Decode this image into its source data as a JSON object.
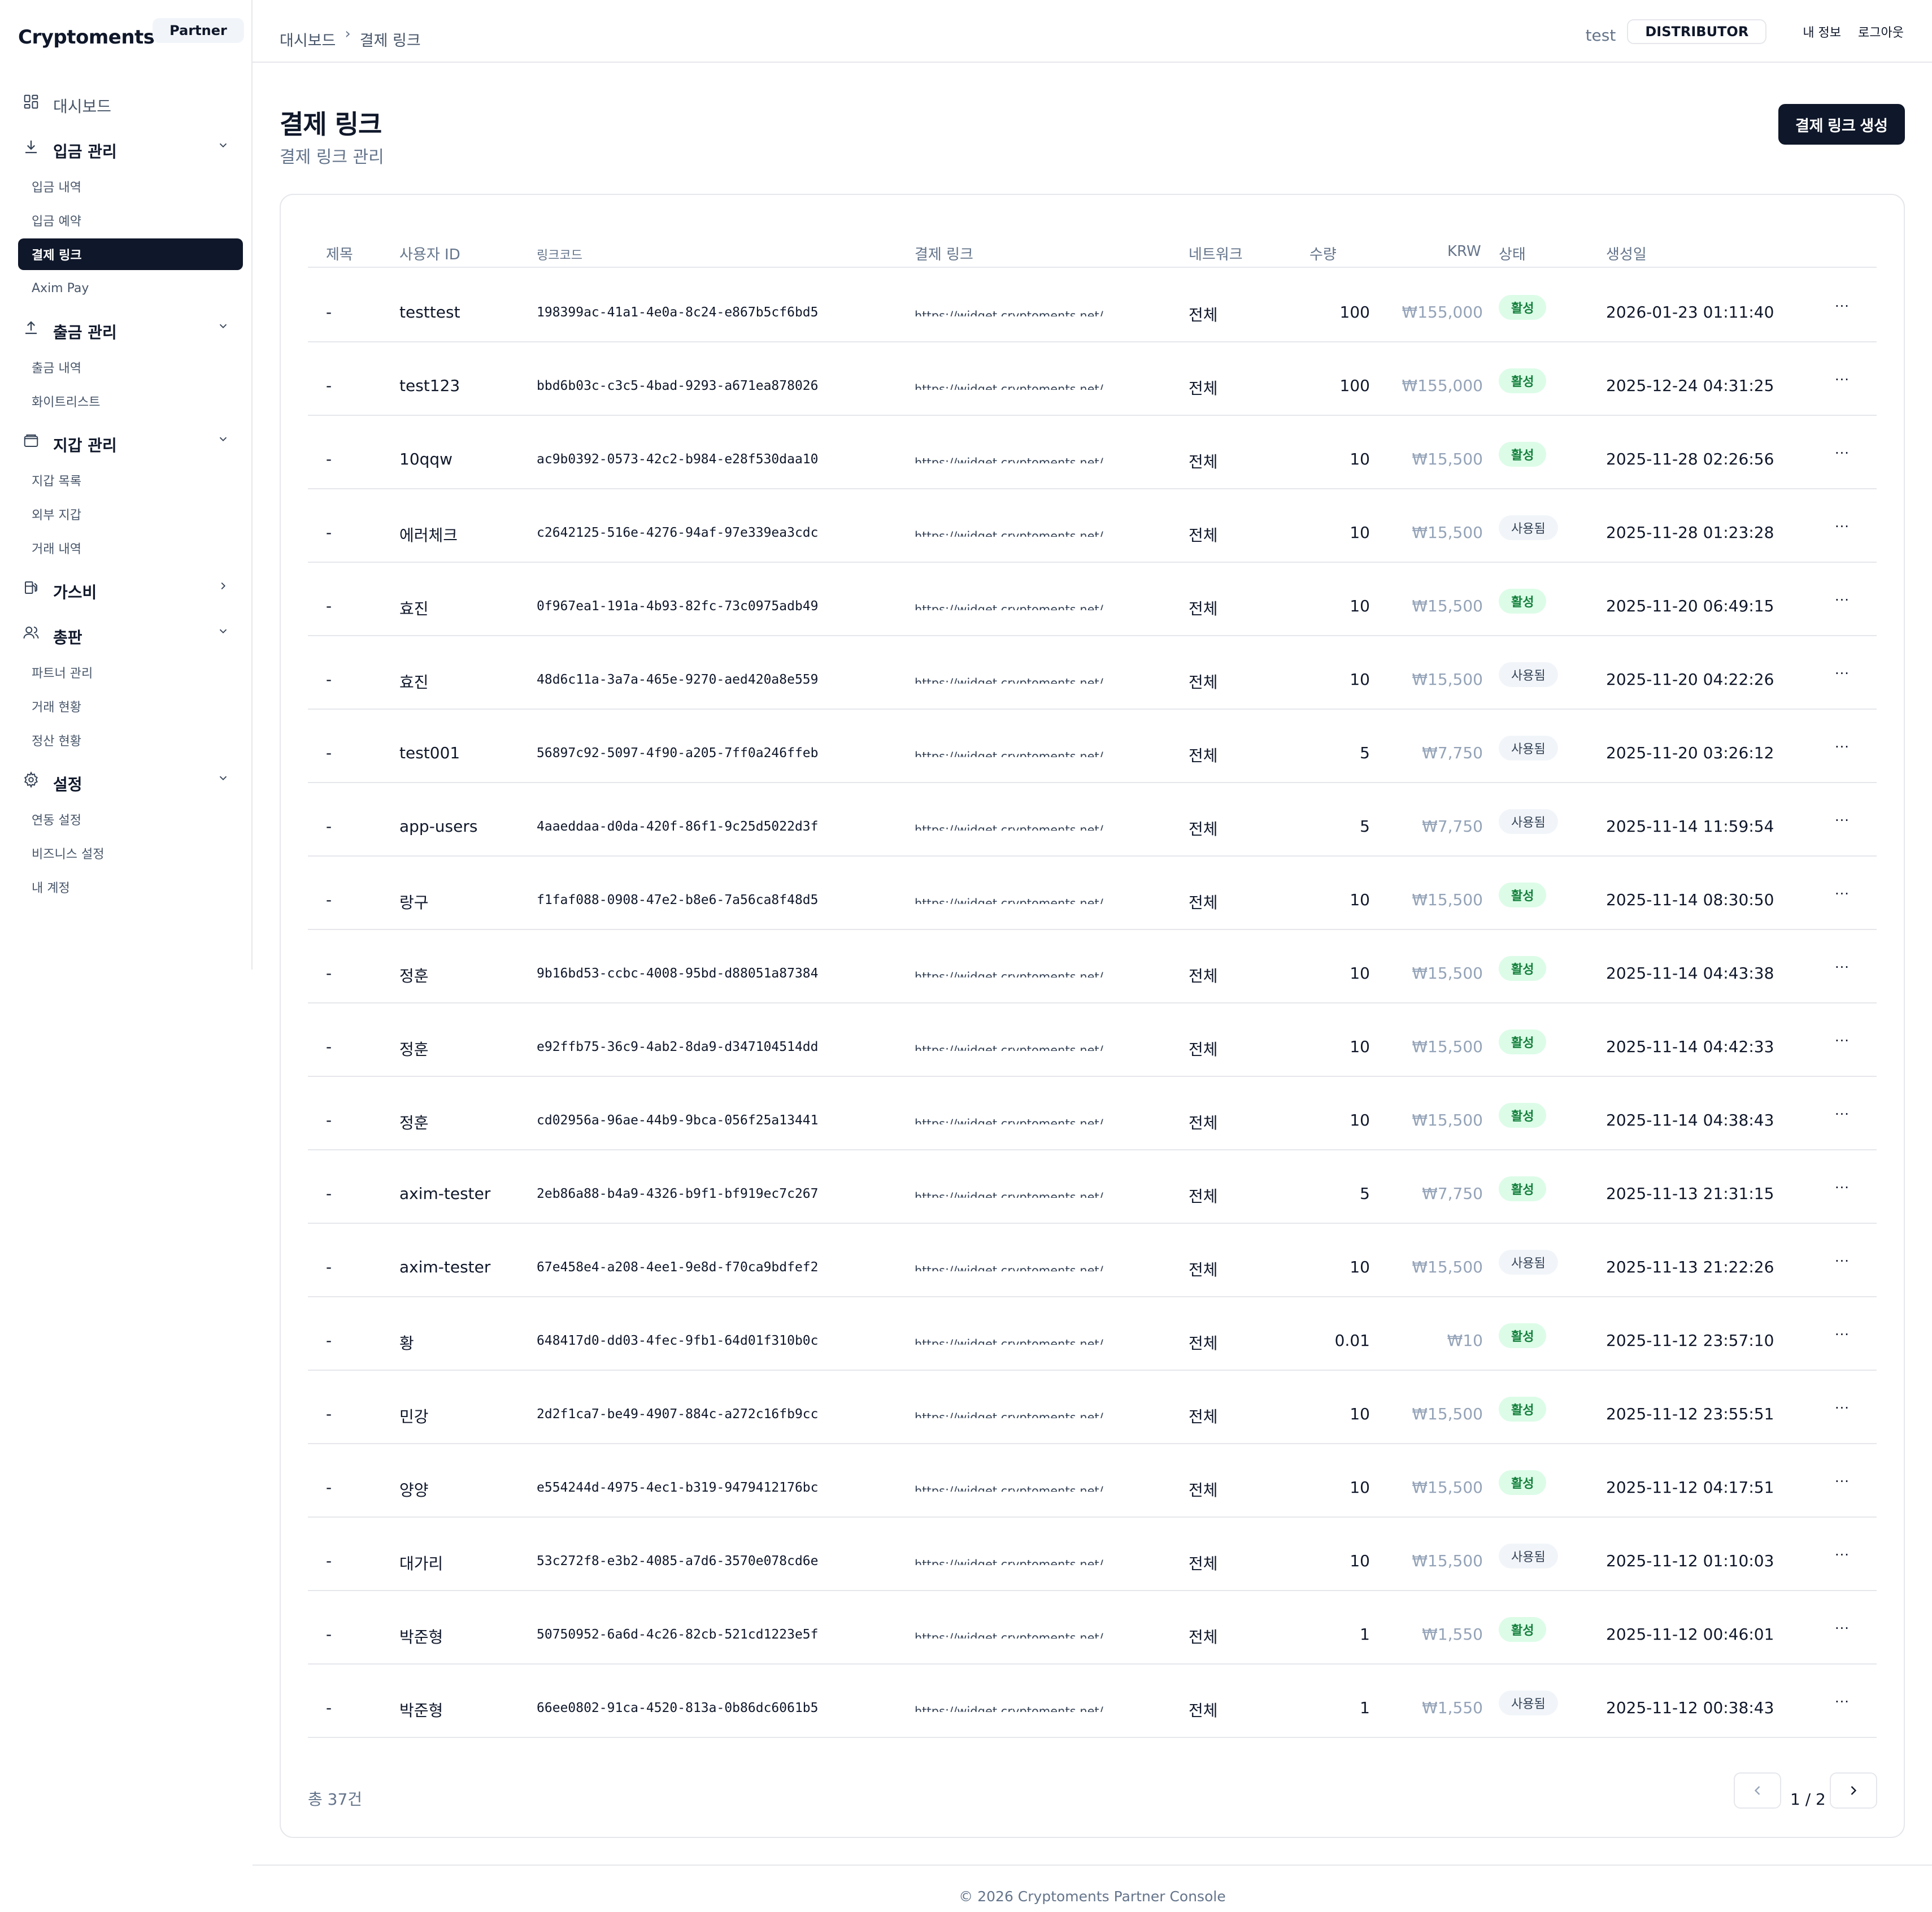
{
  "brand": {
    "name": "Cryptoments",
    "badge": "Partner"
  },
  "sidebar": {
    "groups": [
      {
        "icon": "dashboard-icon",
        "label": "대시보드",
        "children": []
      },
      {
        "icon": "download-icon",
        "label": "입금 관리",
        "expanded": true,
        "children": [
          "입금 내역",
          "입금 예약",
          "결제 링크",
          "Axim Pay"
        ]
      },
      {
        "icon": "upload-icon",
        "label": "출금 관리",
        "expanded": true,
        "children": [
          "출금 내역",
          "화이트리스트"
        ]
      },
      {
        "icon": "wallet-icon",
        "label": "지갑 관리",
        "expanded": true,
        "children": [
          "지갑 목록",
          "외부 지갑",
          "거래 내역"
        ]
      },
      {
        "icon": "gas-pump-icon",
        "label": "가스비",
        "expanded": false,
        "children": []
      },
      {
        "icon": "users-icon",
        "label": "총판",
        "expanded": true,
        "children": [
          "파트너 관리",
          "거래 현황",
          "정산 현황"
        ]
      },
      {
        "icon": "gear-icon",
        "label": "설정",
        "expanded": true,
        "children": [
          "연동 설정",
          "비즈니스 설정",
          "내 계정"
        ]
      }
    ],
    "active_item": "결제 링크"
  },
  "header": {
    "breadcrumb": [
      "대시보드",
      "결제 링크"
    ],
    "username": "test",
    "role": "DISTRIBUTOR",
    "links": [
      "내 정보",
      "로그아웃"
    ]
  },
  "main": {
    "title": "결제 링크",
    "subtitle": "결제 링크 관리",
    "create_button": "결제 링크 생성"
  },
  "table": {
    "columns": [
      "제목",
      "사용자 ID",
      "링크코드",
      "결제 링크",
      "네트워크",
      "수량",
      "KRW",
      "상태",
      "생성일"
    ],
    "rows": [
      {
        "title": "-",
        "user": "testtest",
        "code": "198399ac-41a1-4e0a-8c24-e867b5cf6bd5",
        "link": "https://widget.cryptoments.net/",
        "network": "전체",
        "qty": "100",
        "krw": "₩155,000",
        "status": "활성",
        "date": "2026-01-23 01:11:40"
      },
      {
        "title": "-",
        "user": "test123",
        "code": "bbd6b03c-c3c5-4bad-9293-a671ea878026",
        "link": "https://widget.cryptoments.net/",
        "network": "전체",
        "qty": "100",
        "krw": "₩155,000",
        "status": "활성",
        "date": "2025-12-24 04:31:25"
      },
      {
        "title": "-",
        "user": "10qqw",
        "code": "ac9b0392-0573-42c2-b984-e28f530daa10",
        "link": "https://widget.cryptoments.net/",
        "network": "전체",
        "qty": "10",
        "krw": "₩15,500",
        "status": "활성",
        "date": "2025-11-28 02:26:56"
      },
      {
        "title": "-",
        "user": "에러체크",
        "code": "c2642125-516e-4276-94af-97e339ea3cdc",
        "link": "https://widget.cryptoments.net/",
        "network": "전체",
        "qty": "10",
        "krw": "₩15,500",
        "status": "사용됨",
        "date": "2025-11-28 01:23:28"
      },
      {
        "title": "-",
        "user": "효진",
        "code": "0f967ea1-191a-4b93-82fc-73c0975adb49",
        "link": "https://widget.cryptoments.net/",
        "network": "전체",
        "qty": "10",
        "krw": "₩15,500",
        "status": "활성",
        "date": "2025-11-20 06:49:15"
      },
      {
        "title": "-",
        "user": "효진",
        "code": "48d6c11a-3a7a-465e-9270-aed420a8e559",
        "link": "https://widget.cryptoments.net/",
        "network": "전체",
        "qty": "10",
        "krw": "₩15,500",
        "status": "사용됨",
        "date": "2025-11-20 04:22:26"
      },
      {
        "title": "-",
        "user": "test001",
        "code": "56897c92-5097-4f90-a205-7ff0a246ffeb",
        "link": "https://widget.cryptoments.net/",
        "network": "전체",
        "qty": "5",
        "krw": "₩7,750",
        "status": "사용됨",
        "date": "2025-11-20 03:26:12"
      },
      {
        "title": "-",
        "user": "app-users",
        "code": "4aaeddaa-d0da-420f-86f1-9c25d5022d3f",
        "link": "https://widget.cryptoments.net/",
        "network": "전체",
        "qty": "5",
        "krw": "₩7,750",
        "status": "사용됨",
        "date": "2025-11-14 11:59:54"
      },
      {
        "title": "-",
        "user": "랑구",
        "code": "f1faf088-0908-47e2-b8e6-7a56ca8f48d5",
        "link": "https://widget.cryptoments.net/",
        "network": "전체",
        "qty": "10",
        "krw": "₩15,500",
        "status": "활성",
        "date": "2025-11-14 08:30:50"
      },
      {
        "title": "-",
        "user": "정훈",
        "code": "9b16bd53-ccbc-4008-95bd-d88051a87384",
        "link": "https://widget.cryptoments.net/",
        "network": "전체",
        "qty": "10",
        "krw": "₩15,500",
        "status": "활성",
        "date": "2025-11-14 04:43:38"
      },
      {
        "title": "-",
        "user": "정훈",
        "code": "e92ffb75-36c9-4ab2-8da9-d347104514dd",
        "link": "https://widget.cryptoments.net/",
        "network": "전체",
        "qty": "10",
        "krw": "₩15,500",
        "status": "활성",
        "date": "2025-11-14 04:42:33"
      },
      {
        "title": "-",
        "user": "정훈",
        "code": "cd02956a-96ae-44b9-9bca-056f25a13441",
        "link": "https://widget.cryptoments.net/",
        "network": "전체",
        "qty": "10",
        "krw": "₩15,500",
        "status": "활성",
        "date": "2025-11-14 04:38:43"
      },
      {
        "title": "-",
        "user": "axim-tester",
        "code": "2eb86a88-b4a9-4326-b9f1-bf919ec7c267",
        "link": "https://widget.cryptoments.net/",
        "network": "전체",
        "qty": "5",
        "krw": "₩7,750",
        "status": "활성",
        "date": "2025-11-13 21:31:15"
      },
      {
        "title": "-",
        "user": "axim-tester",
        "code": "67e458e4-a208-4ee1-9e8d-f70ca9bdfef2",
        "link": "https://widget.cryptoments.net/",
        "network": "전체",
        "qty": "10",
        "krw": "₩15,500",
        "status": "사용됨",
        "date": "2025-11-13 21:22:26"
      },
      {
        "title": "-",
        "user": "황",
        "code": "648417d0-dd03-4fec-9fb1-64d01f310b0c",
        "link": "https://widget.cryptoments.net/",
        "network": "전체",
        "qty": "0.01",
        "krw": "₩10",
        "status": "활성",
        "date": "2025-11-12 23:57:10"
      },
      {
        "title": "-",
        "user": "민강",
        "code": "2d2f1ca7-be49-4907-884c-a272c16fb9cc",
        "link": "https://widget.cryptoments.net/",
        "network": "전체",
        "qty": "10",
        "krw": "₩15,500",
        "status": "활성",
        "date": "2025-11-12 23:55:51"
      },
      {
        "title": "-",
        "user": "양양",
        "code": "e554244d-4975-4ec1-b319-9479412176bc",
        "link": "https://widget.cryptoments.net/",
        "network": "전체",
        "qty": "10",
        "krw": "₩15,500",
        "status": "활성",
        "date": "2025-11-12 04:17:51"
      },
      {
        "title": "-",
        "user": "대가리",
        "code": "53c272f8-e3b2-4085-a7d6-3570e078cd6e",
        "link": "https://widget.cryptoments.net/",
        "network": "전체",
        "qty": "10",
        "krw": "₩15,500",
        "status": "사용됨",
        "date": "2025-11-12 01:10:03"
      },
      {
        "title": "-",
        "user": "박준형",
        "code": "50750952-6a6d-4c26-82cb-521cd1223e5f",
        "link": "https://widget.cryptoments.net/",
        "network": "전체",
        "qty": "1",
        "krw": "₩1,550",
        "status": "활성",
        "date": "2025-11-12 00:46:01"
      },
      {
        "title": "-",
        "user": "박준형",
        "code": "66ee0802-91ca-4520-813a-0b86dc6061b5",
        "link": "https://widget.cryptoments.net/",
        "network": "전체",
        "qty": "1",
        "krw": "₩1,550",
        "status": "사용됨",
        "date": "2025-11-12 00:38:43"
      }
    ],
    "row_action": "···"
  },
  "pagination": {
    "total": "총 37건",
    "page": "1 / 2"
  },
  "footer": {
    "text": "© 2026 Cryptoments Partner Console"
  },
  "colors": {
    "primary": "#0f172a",
    "active_bg": "#dcfce7",
    "active_fg": "#15803d",
    "used_bg": "#f1f5f9",
    "muted": "#64748b",
    "border": "#e5e7eb"
  }
}
